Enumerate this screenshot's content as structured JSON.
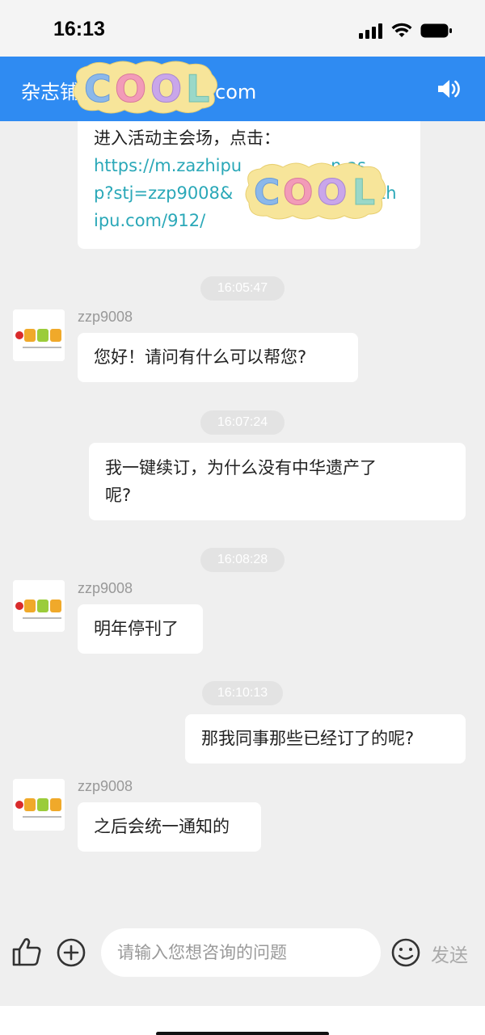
{
  "status": {
    "time": "16:13"
  },
  "nav": {
    "title_left": "杂志铺",
    "title_right": "com"
  },
  "messages": {
    "m1": {
      "line1": "进入活动主会场，点击：",
      "link1": "https://m.zazhipu",
      "link1b": "n.as",
      "link2": "p?stj=zzp9008&",
      "link2b": "zh",
      "link3": "ipu.com/912/"
    },
    "t1": "16:05:47",
    "m2": {
      "sender": "zzp9008",
      "text": "您好！请问有什么可以帮您?"
    },
    "t2": "16:07:24",
    "m3": {
      "line1": "我一键续订，为什么没有中华遗产了",
      "line2": "呢?"
    },
    "t3": "16:08:28",
    "m4": {
      "sender": "zzp9008",
      "text": "明年停刊了"
    },
    "t4": "16:10:13",
    "m5": {
      "text": "那我同事那些已经订了的呢?"
    },
    "m6": {
      "sender": "zzp9008",
      "text": "之后会统一通知的"
    }
  },
  "input": {
    "placeholder": "请输入您想咨询的问题",
    "send_label": "发送"
  },
  "sticker": {
    "text": "COOL"
  },
  "colors": {
    "nav_blue": "#2f8bf2",
    "link_teal": "#2aa8b8",
    "background": "#efefef"
  }
}
